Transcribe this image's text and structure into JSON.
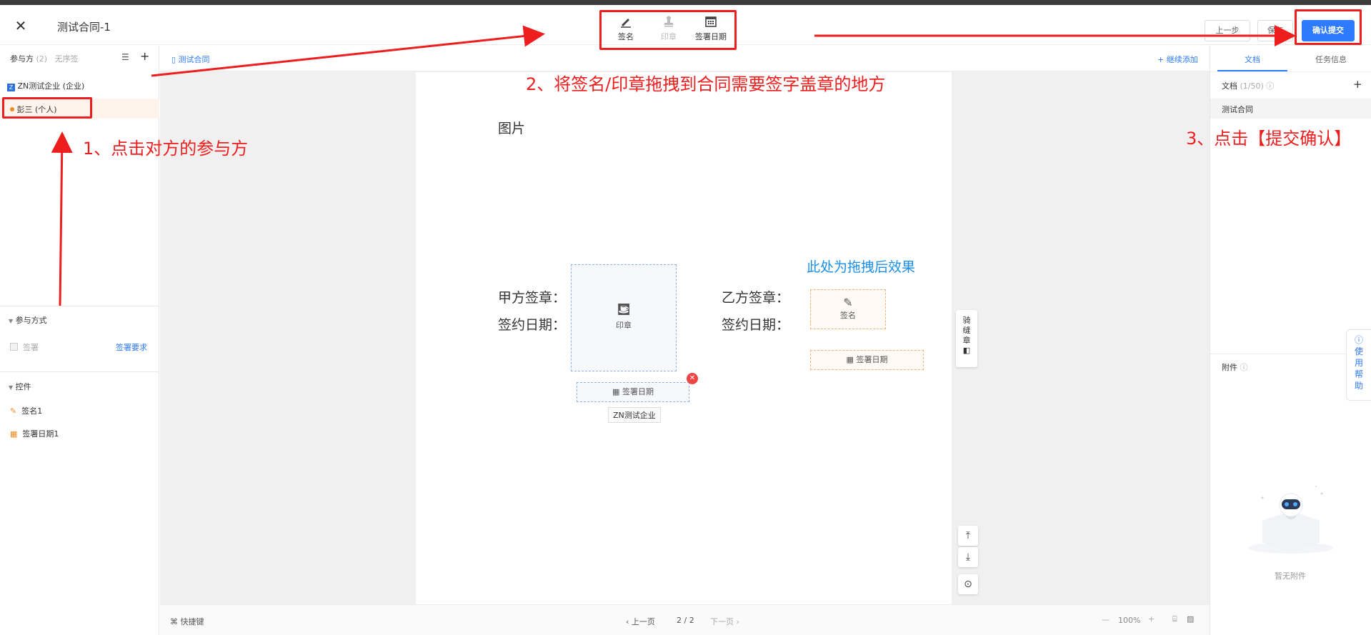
{
  "header": {
    "title": "测试合同-1",
    "tools": {
      "signature": "签名",
      "seal": "印章",
      "sign_date": "签署日期"
    },
    "prev_step": "上一步",
    "save": "保存",
    "confirm_submit": "确认提交"
  },
  "left_panel": {
    "tab_participants": "参与方",
    "participant_count": "(2)",
    "tab_unordered": "无序签",
    "parties": [
      {
        "name": "ZN测试企业 (企业)"
      },
      {
        "name": "彭三 (个人)"
      }
    ],
    "section_method": "参与方式",
    "method_sign": "签署",
    "sign_requirements": "签署要求",
    "section_controls": "控件",
    "controls": [
      {
        "name": "签名1"
      },
      {
        "name": "签署日期1"
      }
    ]
  },
  "center": {
    "breadcrumb": "测试合同",
    "continue_add": "+ 继续添加",
    "doc": {
      "image_label": "图片",
      "party_a_seal": "甲方签章：",
      "party_a_date": "签约日期：",
      "party_b_seal": "乙方签章：",
      "party_b_date": "签约日期：",
      "seal_box": "印章",
      "sign_box": "签名",
      "date_box": "签署日期",
      "company_tag": "ZN测试企业"
    },
    "side_vertical": "骑缝章",
    "bottom": {
      "shortcuts": "快捷键",
      "prev_page": "上一页",
      "page": "2 / 2",
      "next_page": "下一页",
      "zoom": "100%"
    }
  },
  "right_panel": {
    "tab_docs": "文档",
    "tab_task": "任务信息",
    "docs_label": "文档",
    "docs_count": "(1/50)",
    "doc_item": "测试合同",
    "attachments_label": "附件",
    "no_attachment": "暂无附件",
    "help": [
      "使",
      "用",
      "帮",
      "助"
    ]
  },
  "annotations": {
    "step1": "1、点击对方的参与方",
    "step2": "2、将签名/印章拖拽到合同需要签字盖章的地方",
    "step3": "3、点击【提交确认】",
    "drag_effect": "此处为拖拽后效果"
  },
  "colors": {
    "accent": "#2f7bff",
    "annotation_red": "#ee1e1e",
    "drag_text_blue": "#1a8fe8",
    "party_orange": "#f08a24"
  }
}
